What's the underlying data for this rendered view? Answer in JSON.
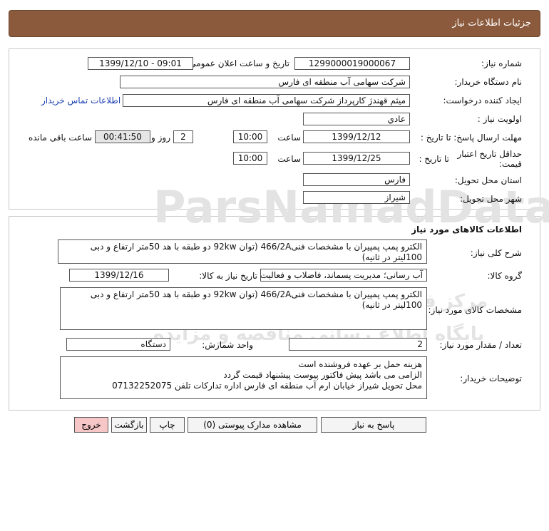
{
  "page_title": "جزئیات اطلاعات نیاز",
  "labels": {
    "need_number": "شماره نیاز:",
    "announce_datetime": "تاریخ و ساعت اعلان عمومی:",
    "buyer_org": "نام دستگاه خریدار:",
    "requester": "ایجاد کننده درخواست:",
    "priority": "اولویت نیاز :",
    "deadline_reply": "مهلت ارسال پاسخ: تا تاریخ :",
    "time": "ساعت",
    "day_and": "روز و",
    "hours_left": "ساعت باقی مانده",
    "price_validity_1": "حداقل تاریخ اعتبار",
    "price_validity_2": "قیمت:",
    "until_date": "تا تاریخ :",
    "province": "استان محل تحویل:",
    "city": "شهر محل تحویل:",
    "goods_section": "اطلاعات کالاهای مورد نیاز",
    "general_desc": "شرح کلی نیاز:",
    "goods_group": "گروه کالا:",
    "need_date_goods": "تاریخ نیاز به کالا:",
    "goods_specs": "مشخصات کالای مورد نیاز:",
    "quantity": "تعداد / مقدار مورد نیاز:",
    "unit": "واحد شمارش:",
    "buyer_notes": "توضیحات خریدار:"
  },
  "values": {
    "need_number": "1299000019000067",
    "announce_datetime": "1399/12/10 - 09:01",
    "buyer_org": "شرکت سهامی آب منطقه ای فارس",
    "requester": "میثم قهندژ کارپرداز شرکت سهامی آب منطقه ای فارس",
    "contact_link": "اطلاعات تماس خریدار",
    "priority": "عادي",
    "reply_date": "1399/12/12",
    "reply_time": "10:00",
    "days_left": "2",
    "countdown": "00:41:50",
    "validity_date": "1399/12/25",
    "validity_time": "10:00",
    "province": "فارس",
    "city": "شیراز",
    "general_desc": "الکترو پمپ پمپیران با مشخصات فنی466/2A (توان 92kw دو طبقه با هد 50متر ارتفاع و دبی 100لیتر در ثانیه)",
    "goods_group": "آب رسانی؛ مدیریت پسماند، فاضلاب و فعالیت های",
    "need_date_goods": "1399/12/16",
    "goods_specs": "الکترو پمپ پمپیران با مشخصات فنی466/2A (توان 92kw دو طبقه با هد 50متر ارتفاع و دبی 100لیتر در ثانیه)",
    "quantity": "2",
    "unit": "دستگاه",
    "notes_1": "هزینه حمل بر عهده فروشنده است",
    "notes_2": "الزامی  می باشد پیش فاکتور پیوست پیشنهاد قیمت گردد",
    "notes_3": "محل تحویل شیراز خیابان ارم آب منطقه ای فارس اداره تدارکات تلفن 07132252075"
  },
  "buttons": {
    "reply": "پاسخ به نیاز",
    "attachments": "مشاهده مدارک پیوستی (0)",
    "print": "چاپ",
    "back": "بازگشت",
    "exit": "خروج"
  },
  "watermark": {
    "line1": "ParsNamadData",
    "line2": "مرکز فراوری اطلاعات پارس نماد داده",
    "line3": "پایگاه اطلاع رسانی مناقصه و مزایده"
  }
}
